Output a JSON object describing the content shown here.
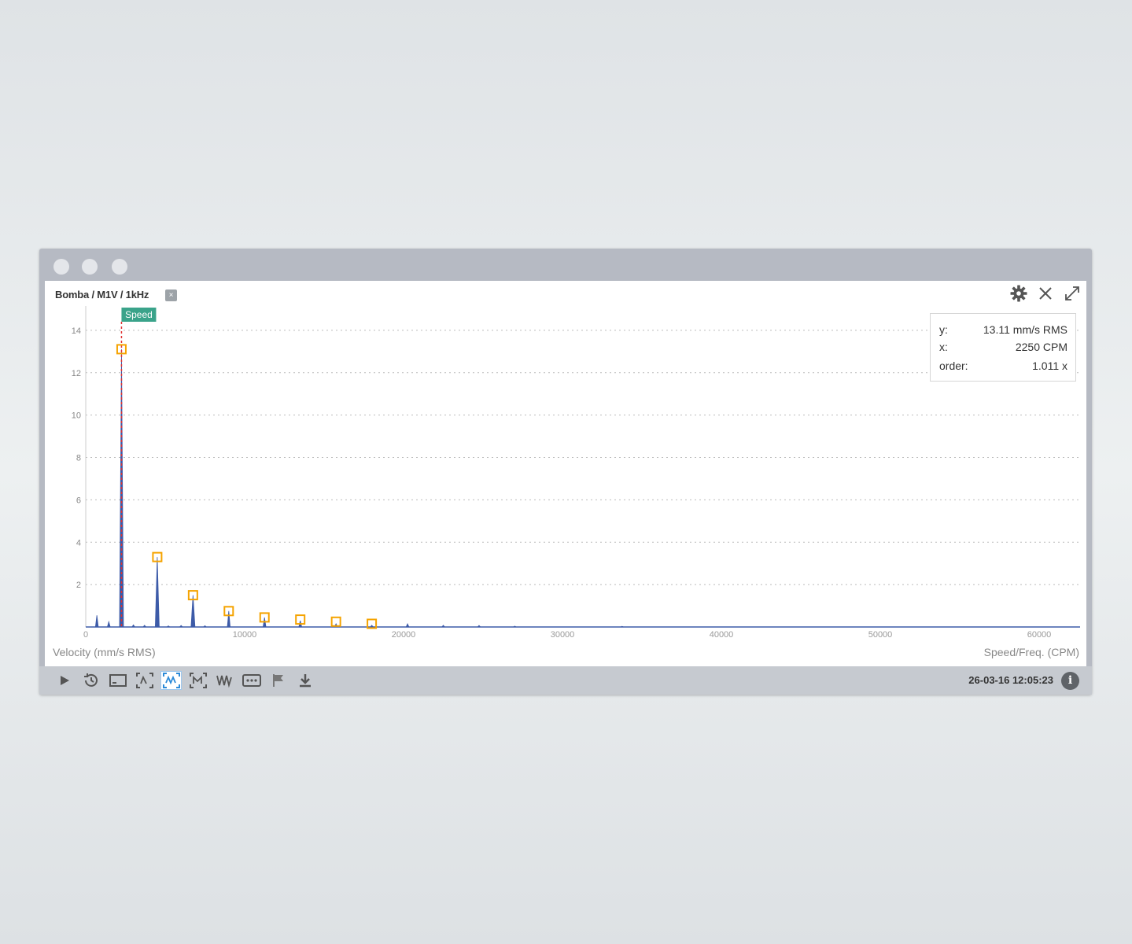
{
  "window": {
    "traffic_lights": [
      "dot",
      "dot",
      "dot"
    ]
  },
  "panel": {
    "title": "Bomba / M1V / 1kHz",
    "title_badge": "×",
    "icons": [
      "gear-icon",
      "close-icon",
      "expand-icon"
    ]
  },
  "tooltip": {
    "y_label": "y:",
    "y_value": "13.11 mm/s RMS",
    "x_label": "x:",
    "x_value": "2250 CPM",
    "order_label": "order:",
    "order_value": "1.011 x"
  },
  "chart_data": {
    "type": "line",
    "ylabel": "Velocity (mm/s RMS)",
    "xlabel": "Speed/Freq. (CPM)",
    "xlim": [
      0,
      60000
    ],
    "ylim": [
      0,
      15
    ],
    "x_ticks": [
      0,
      10000,
      20000,
      30000,
      40000,
      50000,
      60000
    ],
    "x_tick_labels": [
      "0",
      "10000",
      "20000",
      "30000",
      "40000",
      "50000",
      "60000"
    ],
    "y_ticks": [
      2,
      4,
      6,
      8,
      10,
      12,
      14
    ],
    "y_tick_labels": [
      "2",
      "4",
      "6",
      "8",
      "10",
      "12",
      "14"
    ],
    "grid": true,
    "speed_marker": {
      "label": "Speed",
      "x": 2250
    },
    "peaks": [
      {
        "x": 700,
        "y": 0.55
      },
      {
        "x": 1450,
        "y": 0.25
      },
      {
        "x": 2250,
        "y": 13.11
      },
      {
        "x": 3000,
        "y": 0.1
      },
      {
        "x": 3700,
        "y": 0.08
      },
      {
        "x": 4500,
        "y": 3.3
      },
      {
        "x": 5200,
        "y": 0.05
      },
      {
        "x": 6000,
        "y": 0.07
      },
      {
        "x": 6750,
        "y": 1.5
      },
      {
        "x": 7500,
        "y": 0.06
      },
      {
        "x": 9000,
        "y": 0.75
      },
      {
        "x": 11250,
        "y": 0.45
      },
      {
        "x": 13500,
        "y": 0.3
      },
      {
        "x": 15750,
        "y": 0.15
      },
      {
        "x": 18000,
        "y": 0.08
      },
      {
        "x": 20250,
        "y": 0.15
      },
      {
        "x": 22500,
        "y": 0.08
      },
      {
        "x": 24750,
        "y": 0.07
      },
      {
        "x": 27000,
        "y": 0.04
      },
      {
        "x": 33750,
        "y": 0.03
      }
    ],
    "harmonic_markers": [
      {
        "x": 2250,
        "y": 13.11
      },
      {
        "x": 4500,
        "y": 3.3
      },
      {
        "x": 6750,
        "y": 1.5
      },
      {
        "x": 9000,
        "y": 0.75
      },
      {
        "x": 11250,
        "y": 0.45
      },
      {
        "x": 13500,
        "y": 0.35
      },
      {
        "x": 15750,
        "y": 0.25
      },
      {
        "x": 18000,
        "y": 0.15
      }
    ],
    "colors": {
      "line": "#3d5ba8",
      "marker": "#f5a300",
      "speed": "#3aa38a",
      "speed_line": "#e03030",
      "grid": "#bbbbbb"
    }
  },
  "toolbar": {
    "icons": [
      "play-icon",
      "history-icon",
      "window-icon",
      "spectrum-fit-icon",
      "waveform-active-icon",
      "zoom-wave-icon",
      "wave-icon",
      "more-icon",
      "flag-icon",
      "download-icon"
    ],
    "timestamp": "26-03-16 12:05:23",
    "info": "i"
  }
}
